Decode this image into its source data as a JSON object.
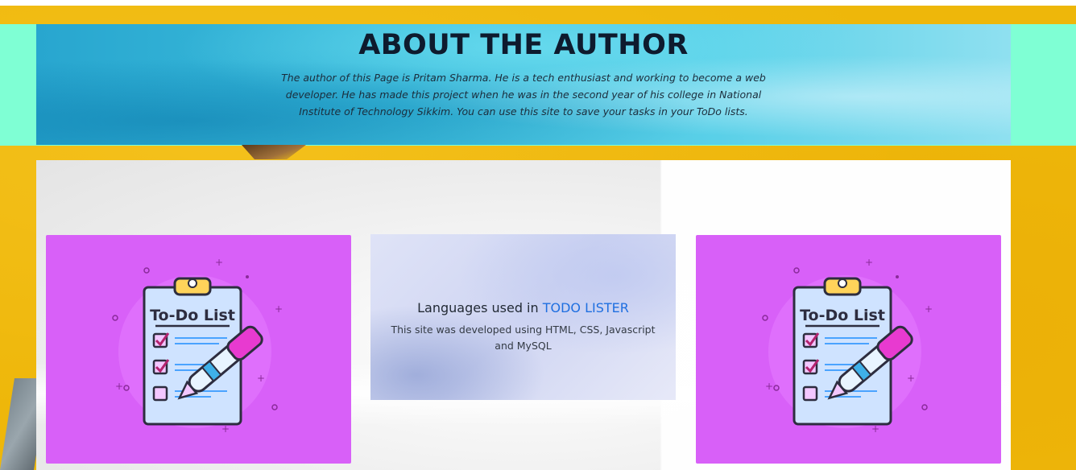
{
  "about": {
    "title": "ABOUT THE AUTHOR",
    "description": "The author of this Page is Pritam Sharma. He is a tech enthusiast and working to become a web developer. He has made this project when he was in the second year of his college in National Institute of Technology Sikkim. You can use this site to save your tasks in your ToDo lists."
  },
  "cards": {
    "left": {
      "image_text": "To-Do List",
      "icon": "todo-clipboard-pen-illustration"
    },
    "right": {
      "image_text": "To-Do List",
      "icon": "todo-clipboard-pen-illustration"
    },
    "center": {
      "heading_prefix": "Languages used in ",
      "heading_accent": "TODO LISTER",
      "body": "This site was developed using HTML, CSS, Javascript and MySQL"
    }
  },
  "colors": {
    "page_background": "#eeb70a",
    "mint_band": "#7fffd4",
    "card_purple": "#d860f8",
    "accent_blue": "#1f6fe0",
    "title_dark": "#0e1b2e"
  }
}
